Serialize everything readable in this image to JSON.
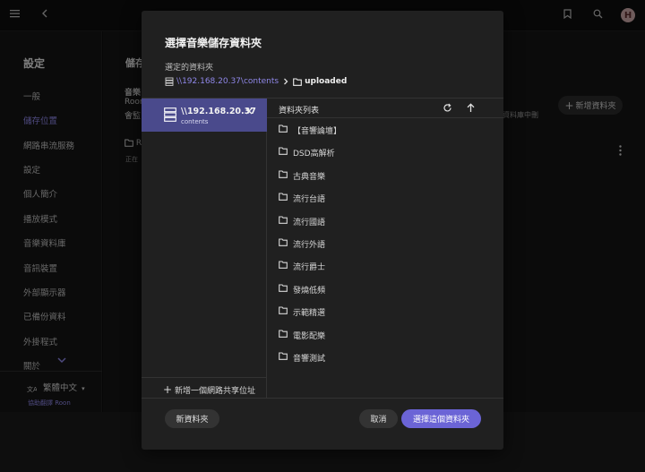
{
  "topbar": {
    "menu_icon": "hamburger-icon",
    "back_icon": "chevron-left-icon",
    "bookmark_icon": "bookmark-icon",
    "search_icon": "search-icon",
    "avatar_letter": "H"
  },
  "sidebar": {
    "title": "設定",
    "items": [
      {
        "label": "一般"
      },
      {
        "label": "儲存位置",
        "active": true
      },
      {
        "label": "網路串流服務"
      },
      {
        "label": "設定"
      },
      {
        "label": "個人簡介"
      },
      {
        "label": "播放模式"
      },
      {
        "label": "音樂資料庫"
      },
      {
        "label": "音訊裝置"
      },
      {
        "label": "外部顯示器"
      },
      {
        "label": "已備份資料"
      },
      {
        "label": "外掛程式"
      },
      {
        "label": "關於"
      }
    ],
    "language": "繁體中文",
    "help_translate": "協助翻譯 Roon"
  },
  "background_page": {
    "heading": "儲存",
    "line1": "音樂",
    "line2": "Roon",
    "line3": "會監",
    "folder_label": "R",
    "status_text": "正在",
    "library_text": "資料庫中刪",
    "add_folder_button": "新增資料夾"
  },
  "dialog": {
    "title": "選擇音樂儲存資料夾",
    "selected_label": "選定的資料夾",
    "path_share": "\\\\192.168.20.37\\contents",
    "path_current": "uploaded",
    "share": {
      "name": "\\\\192.168.20.37",
      "sub": "contents"
    },
    "add_share_label": "新增一個網路共享位址",
    "list_title": "資料夾列表",
    "folders": [
      "【音響論壇】",
      "DSD高解析",
      "古典音樂",
      "流行台語",
      "流行國語",
      "流行外語",
      "流行爵士",
      "發燒低頻",
      "示範精選",
      "電影配樂",
      "音響測試"
    ],
    "new_folder_button": "新資料夾",
    "cancel_button": "取消",
    "select_button": "選擇這個資料夾"
  },
  "colors": {
    "accent": "#8f87e8",
    "primary_button": "#6b64d6",
    "selected_share": "#4a4a8c",
    "dialog_bg": "#202020"
  }
}
